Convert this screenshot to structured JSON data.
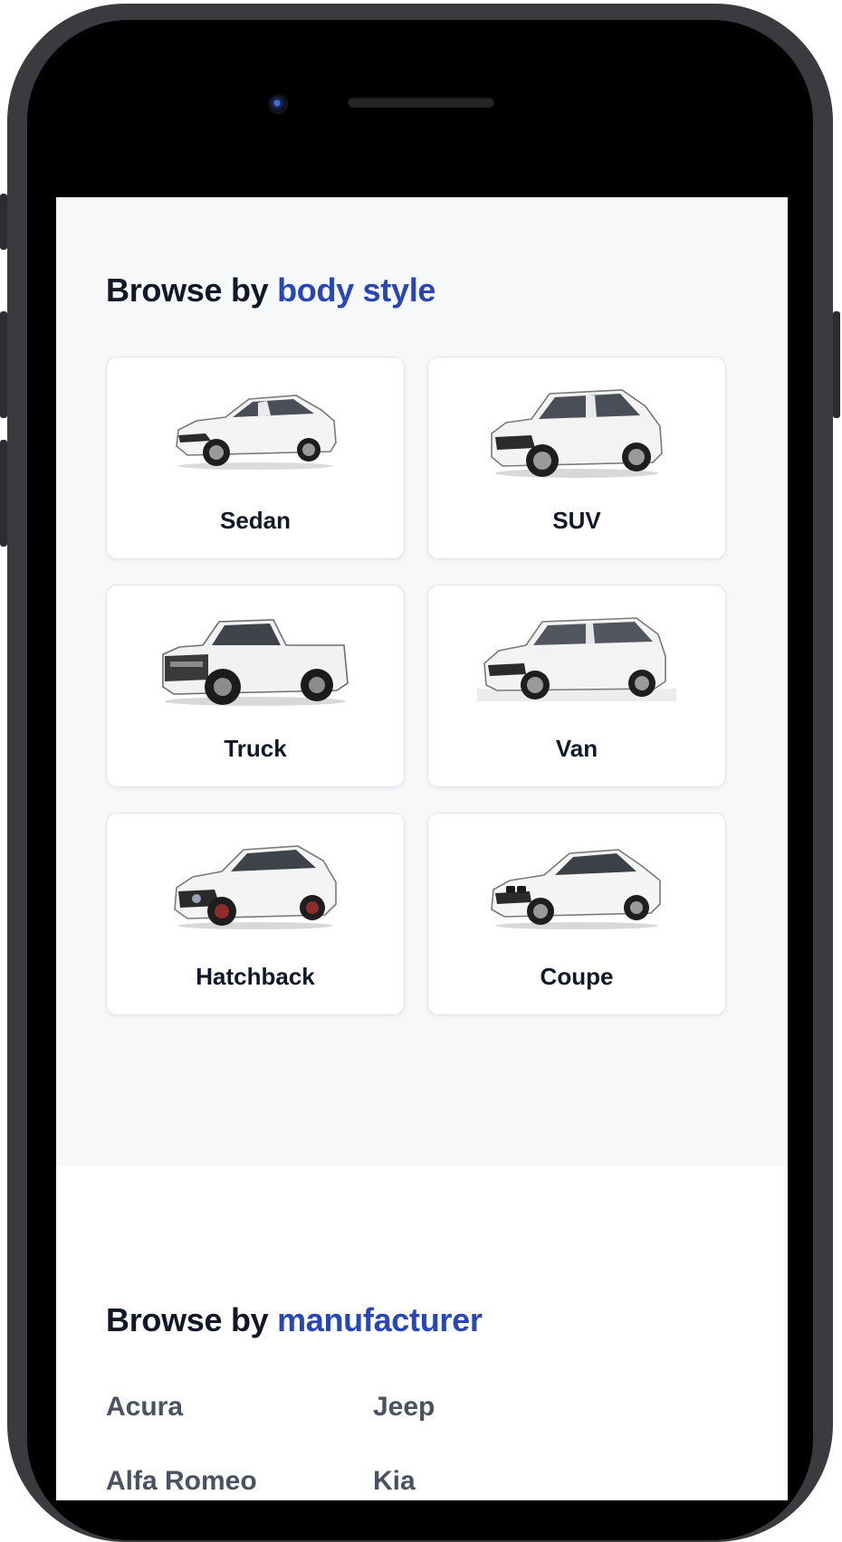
{
  "body_style": {
    "title_prefix": "Browse by",
    "title_accent": "body style",
    "cards": [
      {
        "label": "Sedan",
        "icon": "sedan-car"
      },
      {
        "label": "SUV",
        "icon": "suv-car"
      },
      {
        "label": "Truck",
        "icon": "truck-car"
      },
      {
        "label": "Van",
        "icon": "van-car"
      },
      {
        "label": "Hatchback",
        "icon": "hatchback-car"
      },
      {
        "label": "Coupe",
        "icon": "coupe-car"
      }
    ]
  },
  "manufacturer": {
    "title_prefix": "Browse by",
    "title_accent": "manufacturer",
    "items": [
      "Acura",
      "Jeep",
      "Alfa Romeo",
      "Kia"
    ]
  },
  "colors": {
    "accent": "#2746b8",
    "heading": "#121826",
    "background": "#f7f8fa"
  }
}
